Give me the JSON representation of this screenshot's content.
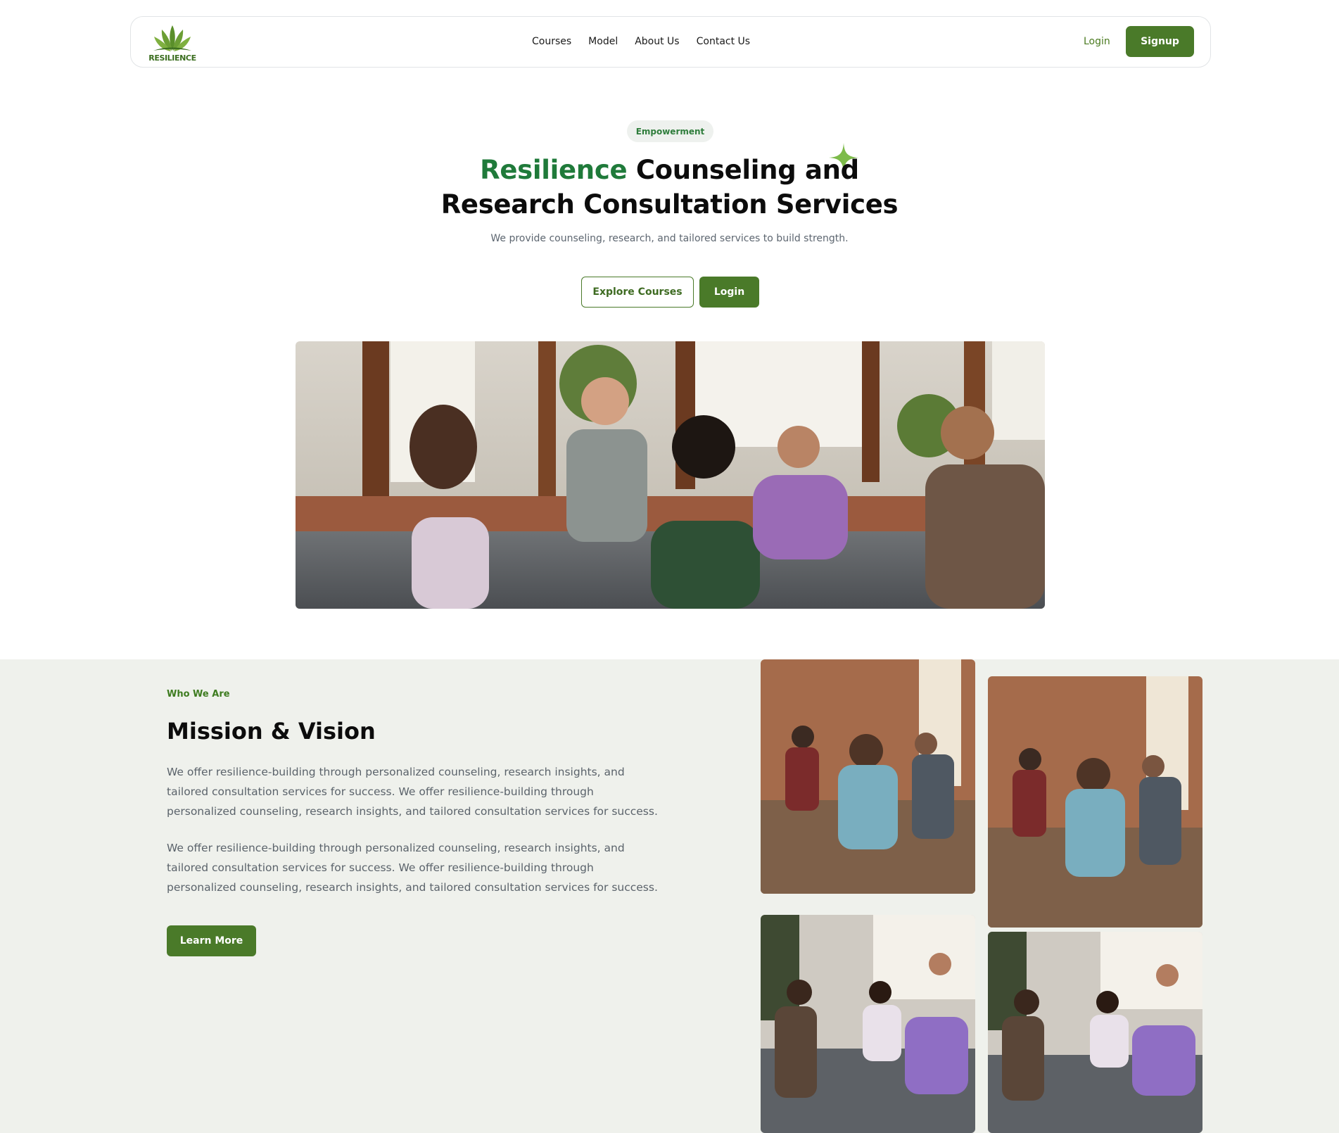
{
  "nav": {
    "logo_text": "RESILIENCE",
    "links": [
      "Courses",
      "Model",
      "About Us",
      "Contact Us"
    ],
    "login_label": "Login",
    "signup_label": "Signup"
  },
  "hero": {
    "badge": "Empowerment",
    "title_accent": "Resilience",
    "title_line1_rest": " Counseling and",
    "title_line2": "Research Consultation Services",
    "subtitle": "We provide counseling, research, and tailored services to build strength.",
    "explore_label": "Explore Courses",
    "login_label": "Login"
  },
  "about": {
    "eyebrow": "Who We Are",
    "title": "Mission & Vision",
    "paragraph1": "We offer resilience-building through personalized counseling, research insights, and tailored consultation services for success. We offer resilience-building through personalized counseling, research insights, and tailored consultation services for success.",
    "paragraph2": "We offer resilience-building through personalized counseling, research insights, and tailored consultation services for success. We offer resilience-building through personalized counseling, research insights, and tailored consultation services for success.",
    "learn_more_label": "Learn More"
  },
  "colors": {
    "brand_green": "#4a7a29",
    "accent_green": "#1f7a3a",
    "section_bg": "#eff1ec"
  }
}
